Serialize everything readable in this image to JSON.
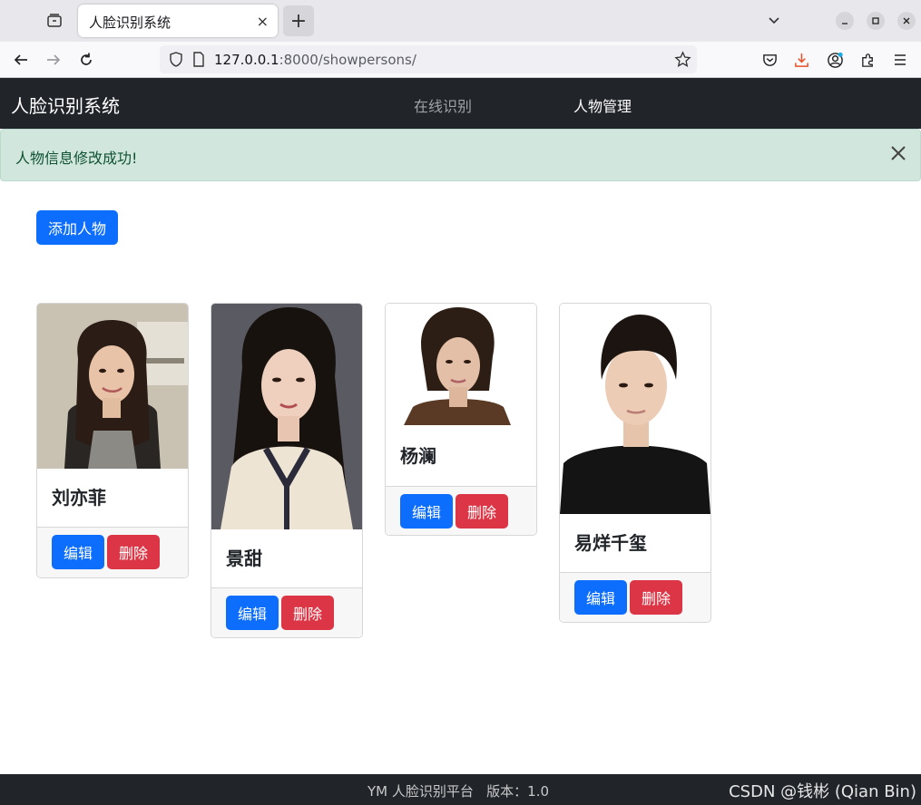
{
  "browser": {
    "tab_title": "人脸识别系统",
    "tab_close": "×",
    "new_tab": "+",
    "url_host": "127.0.0.1",
    "url_rest": ":8000/showpersons/"
  },
  "navbar": {
    "brand": "人脸识别系统",
    "links": [
      {
        "label": "在线识别",
        "active": false
      },
      {
        "label": "人物管理",
        "active": true
      }
    ]
  },
  "alert": {
    "message": "人物信息修改成功!"
  },
  "add_button": "添加人物",
  "cards": [
    {
      "name": "刘亦菲",
      "edit": "编辑",
      "delete": "删除"
    },
    {
      "name": "景甜",
      "edit": "编辑",
      "delete": "删除"
    },
    {
      "name": "杨澜",
      "edit": "编辑",
      "delete": "删除"
    },
    {
      "name": "易烊千玺",
      "edit": "编辑",
      "delete": "删除"
    }
  ],
  "footer": {
    "text": "YM 人脸识别平台   版本：1.0",
    "watermark": "CSDN @钱彬 (Qian Bin)"
  },
  "colors": {
    "primary": "#0d6efd",
    "danger": "#dc3545",
    "dark": "#212529",
    "success_bg": "#d1e7dd"
  }
}
